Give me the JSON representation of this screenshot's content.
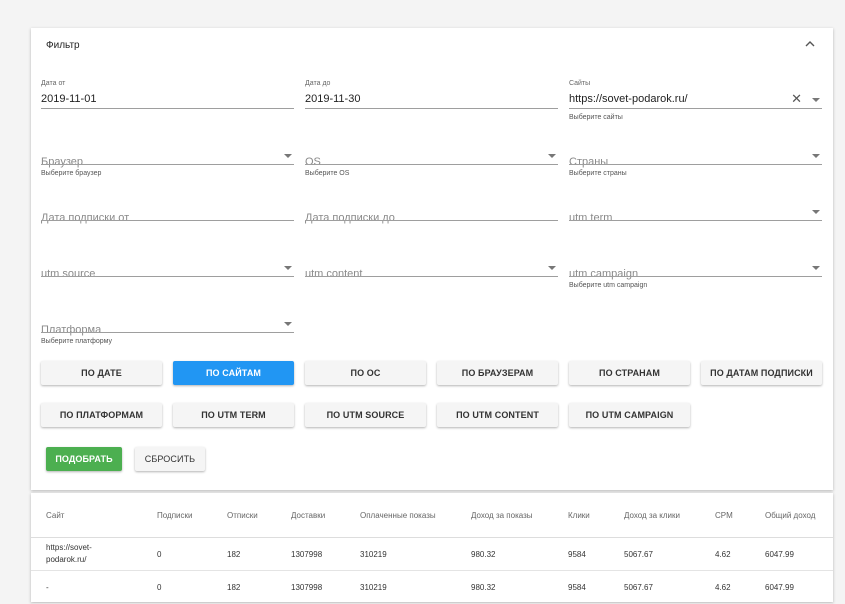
{
  "filter": {
    "title": "Фильтр",
    "date_from": {
      "label": "Дата от",
      "value": "2019-11-01"
    },
    "date_to": {
      "label": "Дата до",
      "value": "2019-11-30"
    },
    "sites": {
      "label": "Сайты",
      "value": "https://sovet-podarok.ru/",
      "hint": "Выберите сайты"
    },
    "browser": {
      "placeholder": "Браузер",
      "hint": "Выберите браузер"
    },
    "os": {
      "placeholder": "OS",
      "hint": "Выберите OS"
    },
    "countries": {
      "placeholder": "Страны",
      "hint": "Выберите страны"
    },
    "sub_date_from": {
      "placeholder": "Дата подписки от"
    },
    "sub_date_to": {
      "placeholder": "Дата подписки до"
    },
    "utm_term": {
      "placeholder": "utm term"
    },
    "utm_source": {
      "placeholder": "utm source"
    },
    "utm_content": {
      "placeholder": "utm content"
    },
    "utm_campaign": {
      "placeholder": "utm campaign",
      "hint": "Выберите utm campaign"
    },
    "platform": {
      "placeholder": "Платформа",
      "hint": "Выберите платформу"
    }
  },
  "group_buttons": [
    {
      "label": "ПО ДАТЕ",
      "active": false
    },
    {
      "label": "ПО САЙТАМ",
      "active": true
    },
    {
      "label": "ПО ОС",
      "active": false
    },
    {
      "label": "ПО БРАУЗЕРАМ",
      "active": false
    },
    {
      "label": "ПО СТРАНАМ",
      "active": false
    },
    {
      "label": "ПО ДАТАМ ПОДПИСКИ",
      "active": false
    },
    {
      "label": "ПО ПЛАТФОРМАМ",
      "active": false
    },
    {
      "label": "ПО UTM TERM",
      "active": false
    },
    {
      "label": "ПО UTM SOURCE",
      "active": false
    },
    {
      "label": "ПО UTM CONTENT",
      "active": false
    },
    {
      "label": "ПО UTM CAMPAIGN",
      "active": false
    }
  ],
  "actions": {
    "apply": "ПОДОБРАТЬ",
    "reset": "СБРОСИТЬ"
  },
  "colors": {
    "primary": "#2196f3",
    "success": "#4caf50"
  },
  "table": {
    "headers": [
      "Сайт",
      "Подписки",
      "Отписки",
      "Доставки",
      "Оплаченные показы",
      "Доход за показы",
      "Клики",
      "Доход за клики",
      "CPM",
      "Общий доход"
    ],
    "rows": [
      [
        "https://sovet-podarok.ru/",
        "0",
        "182",
        "1307998",
        "310219",
        "980.32",
        "9584",
        "5067.67",
        "4.62",
        "6047.99"
      ],
      [
        "-",
        "0",
        "182",
        "1307998",
        "310219",
        "980.32",
        "9584",
        "5067.67",
        "4.62",
        "6047.99"
      ]
    ]
  }
}
